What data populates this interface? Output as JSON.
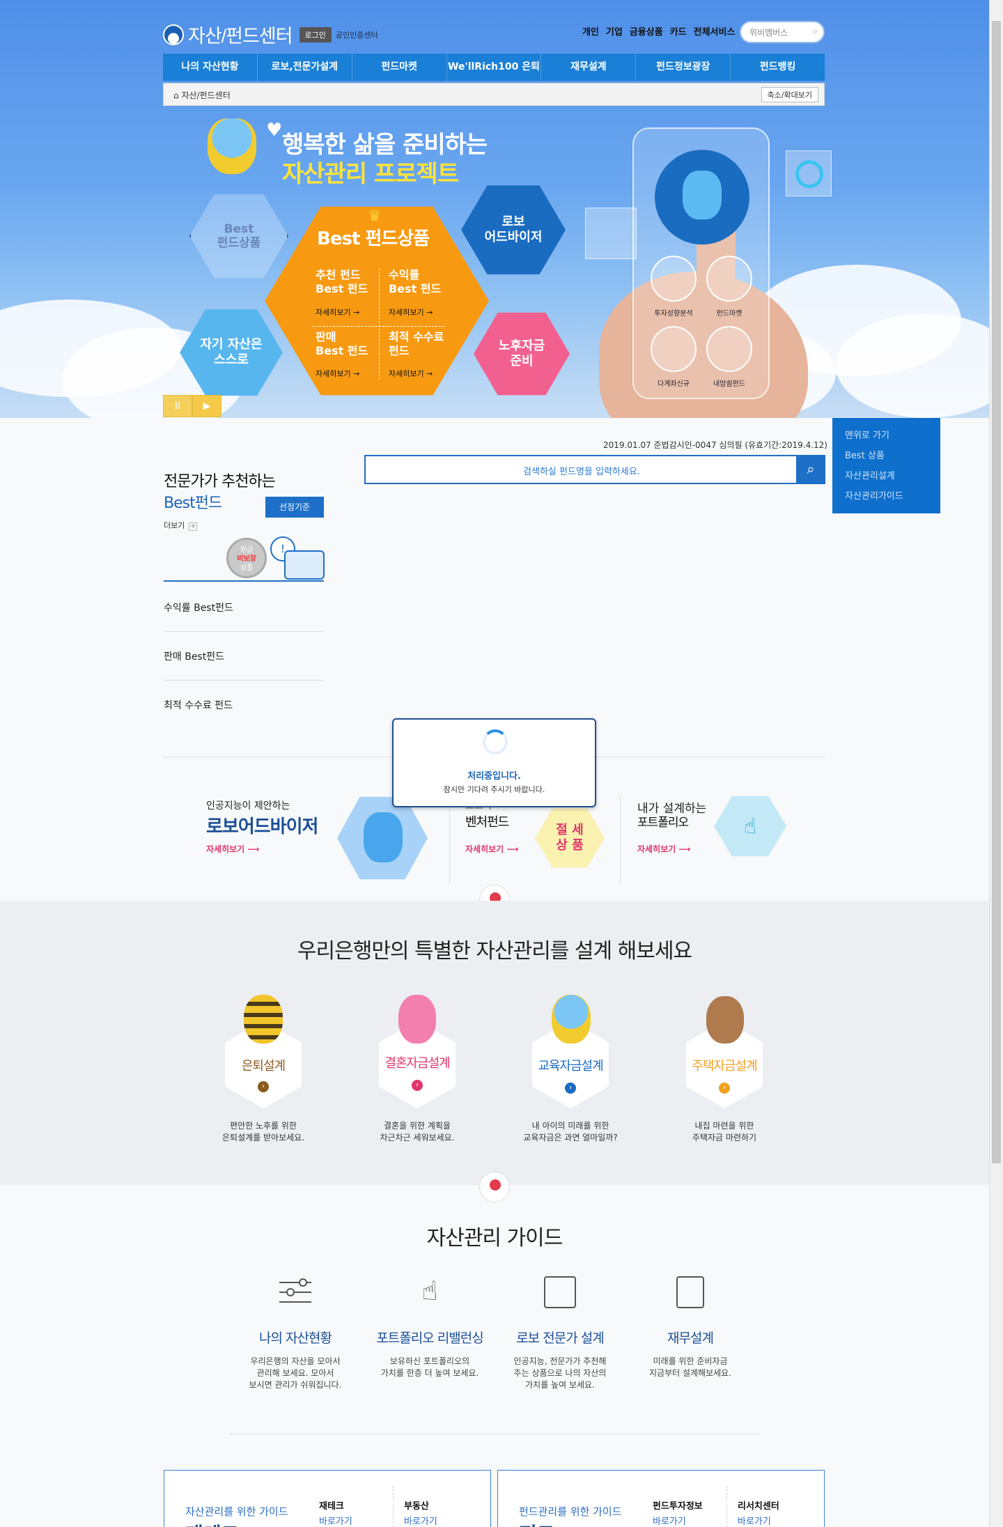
{
  "header": {
    "site_name": "자산/펀드센터",
    "login_label": "로그인",
    "cert_label": "공인인증센터",
    "top_links": [
      "개인",
      "기업",
      "금융상품",
      "카드",
      "전체서비스"
    ],
    "search_placeholder": "위비멤버스"
  },
  "gnb": [
    "나의 자산현황",
    "로보,전문가설계",
    "펀드마켓",
    "We'llRich100 은퇴설계",
    "재무설계",
    "펀드정보광장",
    "펀드뱅킹"
  ],
  "breadcrumb": {
    "home": "자산/펀드센터",
    "zoom": "축소/확대보기"
  },
  "hero": {
    "headline_1": "행복한 삶을 준비하는",
    "headline_2": "자산관리 프로젝트",
    "hex_best_small": "Best\n펀드상품",
    "hex_best_title": "Best 펀드상품",
    "best_cells": [
      {
        "title": "추천 펀드\nBest 펀드",
        "link": "자세히보기 →"
      },
      {
        "title": "수익률\nBest 펀드",
        "link": "자세히보기 →"
      },
      {
        "title": "판매\nBest 펀드",
        "link": "자세히보기 →"
      },
      {
        "title": "최적 수수료\n펀드",
        "link": "자세히보기 →"
      }
    ],
    "hex_robo": "로보\n어드바이저",
    "hex_self": "자기 자산은\n스스로",
    "hex_retire": "노후자금\n준비",
    "phone_icons": [
      "투자성향분석",
      "펀드마켓",
      "다계좌신규",
      "내맘쉼펀드"
    ],
    "player": [
      "II",
      "▶"
    ]
  },
  "quick_menu": [
    "맨위로 가기",
    "Best 상품",
    "자산관리설계",
    "자산관리가이드"
  ],
  "notice": "2019.01.07 준법감시인-0047 심의필 (유효기간:2019.4.12)",
  "fund_search": {
    "placeholder": "검색하실 펀드명을 입력하세요."
  },
  "recommend": {
    "line1": "전문가가 추천하는",
    "line2": "Best펀드",
    "select_button": "선정기준",
    "more": "더보기",
    "badge": [
      "원금",
      "비보장",
      "상품"
    ],
    "categories": [
      "수익률 Best펀드",
      "판매 Best펀드",
      "최적 수수료 펀드"
    ]
  },
  "loading": {
    "title": "처리중입니다.",
    "message": "잠시만 기다려 주시기 바랍니다."
  },
  "strip": [
    {
      "small": "인공지능이 제안하는",
      "big": "로보어드바이저",
      "link": "자세히보기"
    },
    {
      "small": "코스닥",
      "big": "벤처펀드",
      "tag": "절 세\n상 품",
      "link": "자세히보기"
    },
    {
      "small": "내가 설계하는",
      "big": "포트폴리오",
      "link": "자세히보기"
    }
  ],
  "special": {
    "title": "우리은행만의 특별한 자산관리를 설계 해보세요",
    "items": [
      {
        "name": "은퇴설계",
        "desc": "편안한 노후를 위한\n은퇴설계를 받아보세요.",
        "color": "#8b5a1f"
      },
      {
        "name": "결혼자금설계",
        "desc": "결혼을 위한 계획을\n차근차근 세워보세요.",
        "color": "#e0356b"
      },
      {
        "name": "교육자금설계",
        "desc": "내 아이의 미래를 위한\n교육자금은 과연 얼마일까?",
        "color": "#1a6cc0"
      },
      {
        "name": "주택자금설계",
        "desc": "내집 마련을 위한\n주택자금 마련하기",
        "color": "#f0a020"
      }
    ]
  },
  "guide": {
    "title": "자산관리 가이드",
    "items": [
      {
        "name": "나의 자산현황",
        "desc": "우리은행의 자산을 모아서\n관리해 보세요. 모아서\n보시면 관리가 쉬워집니다."
      },
      {
        "name": "포트폴리오 리밸런싱",
        "desc": "보유하신 포트폴리오의\n가치를 한층 더 높여 보세요."
      },
      {
        "name": "로보 전문가 설계",
        "desc": "인공지능, 전문가가 추천해\n주는 상품으로 나의 자산의\n가치를 높여 보세요."
      },
      {
        "name": "재무설계",
        "desc": "미래를 위한 준비자금\n지금부터 설계해보세요."
      }
    ]
  },
  "bottom_boxes": [
    {
      "l1": "자산관리를 위한 가이드",
      "l2": "재테크",
      "cols": [
        {
          "t": "재테크",
          "s": "바로가기"
        },
        {
          "t": "부동산",
          "s": "바로가기"
        }
      ]
    },
    {
      "l1": "펀드관리를 위한 가이드",
      "l2": "펀드",
      "cols": [
        {
          "t": "펀드투자정보",
          "s": "바로가기"
        },
        {
          "t": "리서치센터",
          "s": "바로가기"
        }
      ]
    }
  ]
}
